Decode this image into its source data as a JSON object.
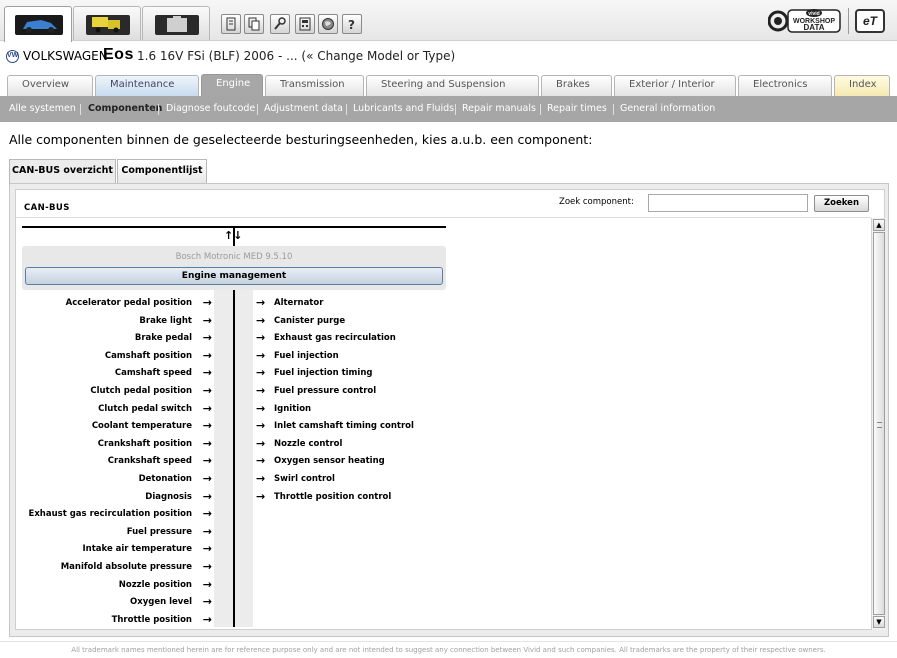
{
  "toolbar": {
    "vehicle_tabs": [
      {
        "icon": "car-icon",
        "active": true
      },
      {
        "icon": "truck-icon",
        "active": false
      },
      {
        "icon": "briefcase-icon",
        "active": false
      }
    ],
    "tools": [
      "document-icon",
      "copy-icon",
      "wrench-icon",
      "calculator-icon",
      "globe-icon",
      "help-icon"
    ],
    "logo_small_text": "vivid",
    "logo_line1": "WORKSHOP",
    "logo_line2": "DATA",
    "logo2_text": "eT"
  },
  "vehicle": {
    "logo_text": "VW",
    "make": "VOLKSWAGEN",
    "model": "Eos",
    "detail": "1.6 16V FSi (BLF) 2006 - ... (« Change Model or Type)"
  },
  "tabs": [
    {
      "label": "Overview"
    },
    {
      "label": "Maintenance"
    },
    {
      "label": "Engine",
      "active": true
    },
    {
      "label": "Transmission"
    },
    {
      "label": "Steering and Suspension"
    },
    {
      "label": "Brakes"
    },
    {
      "label": "Exterior / Interior"
    },
    {
      "label": "Electronics"
    },
    {
      "label": "Index"
    }
  ],
  "subnav": [
    {
      "label": "Alle systemen"
    },
    {
      "label": "Componenten",
      "selected": true
    },
    {
      "label": "Diagnose foutcode"
    },
    {
      "label": "Adjustment data"
    },
    {
      "label": "Lubricants and Fluids"
    },
    {
      "label": "Repair manuals"
    },
    {
      "label": "Repair times"
    },
    {
      "label": "General information"
    }
  ],
  "instruction": "Alle componenten binnen de geselecteerde besturingseenheden, kies a.u.b. een component:",
  "inner_tabs": [
    {
      "label": "CAN-BUS overzicht",
      "active": true
    },
    {
      "label": "Componentlijst"
    }
  ],
  "panel": {
    "canbus_label": "CAN-BUS",
    "search_label": "Zoek component:",
    "search_value": "",
    "search_button": "Zoeken",
    "bus_arrows": "↑↓",
    "ecu_subtitle": "Bosch Motronic MED 9.5.10",
    "ecu_title": "Engine management",
    "inputs": [
      "Accelerator pedal position",
      "Brake light",
      "Brake pedal",
      "Camshaft position",
      "Camshaft speed",
      "Clutch pedal position",
      "Clutch pedal switch",
      "Coolant temperature",
      "Crankshaft position",
      "Crankshaft speed",
      "Detonation",
      "Diagnosis",
      "Exhaust gas recirculation position",
      "Fuel pressure",
      "Intake air temperature",
      "Manifold absolute pressure",
      "Nozzle position",
      "Oxygen level",
      "Throttle position"
    ],
    "outputs": [
      "Alternator",
      "Canister purge",
      "Exhaust gas recirculation",
      "Fuel injection",
      "Fuel injection timing",
      "Fuel pressure control",
      "Ignition",
      "Inlet camshaft timing control",
      "Nozzle control",
      "Oxygen sensor heating",
      "Swirl control",
      "Throttle position control"
    ],
    "arrow_glyph": "→"
  },
  "footer": "All trademark names mentioned herein are for reference purpose only and are not intended to suggest any connection between Vivid and such companies. All trademarks are the property of their respective owners."
}
